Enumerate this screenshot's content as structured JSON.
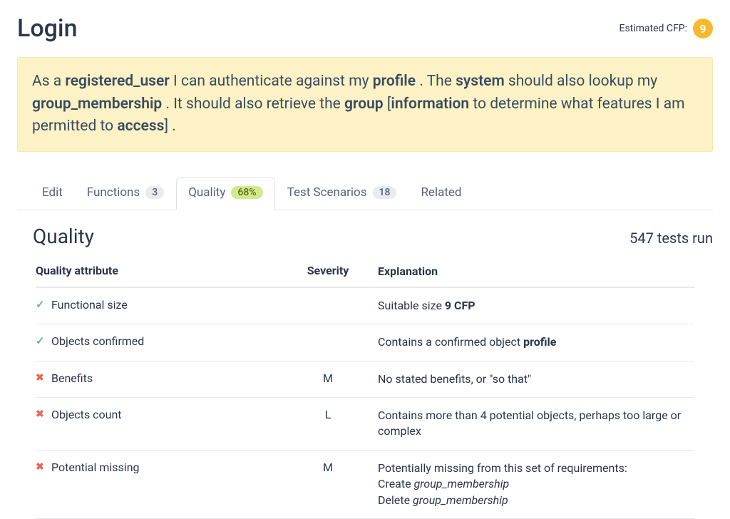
{
  "header": {
    "title": "Login",
    "cfp_label": "Estimated CFP:",
    "cfp_value": "9"
  },
  "story": {
    "s1": "As a ",
    "b1": "registered_user",
    "s2": " I can authenticate against my ",
    "b2": "profile",
    "s3": " . The ",
    "b3": "system",
    "s4": " should also lookup my ",
    "b4": "group_membership",
    "s5": " . It should also retrieve the ",
    "b5": "group",
    "s6": " [",
    "b6": "information",
    "s7": " to determine what features I am permitted to ",
    "b7": "access",
    "s8": "] ."
  },
  "tabs": {
    "edit": "Edit",
    "functions": "Functions",
    "functions_count": "3",
    "quality": "Quality",
    "quality_pct": "68%",
    "test_scenarios": "Test Scenarios",
    "test_scenarios_count": "18",
    "related": "Related"
  },
  "section": {
    "title": "Quality",
    "tests_run": "547 tests run"
  },
  "table": {
    "head_attr": "Quality attribute",
    "head_sev": "Severity",
    "head_exp": "Explanation",
    "rows": [
      {
        "ok": true,
        "attr": "Functional size",
        "sev": "",
        "exp_pre": "Suitable size ",
        "exp_b": "9 CFP",
        "exp_post": ""
      },
      {
        "ok": true,
        "attr": "Objects confirmed",
        "sev": "",
        "exp_pre": "Contains a confirmed object ",
        "exp_b": "profile",
        "exp_post": ""
      },
      {
        "ok": false,
        "attr": "Benefits",
        "sev": "M",
        "exp_pre": "No stated benefits, or \"so that\"",
        "exp_b": "",
        "exp_post": ""
      },
      {
        "ok": false,
        "attr": "Objects count",
        "sev": "L",
        "exp_pre": "Contains more than 4 potential objects, perhaps too large or complex",
        "exp_b": "",
        "exp_post": ""
      },
      {
        "ok": false,
        "attr": "Potential missing",
        "sev": "M",
        "exp_line1": "Potentially missing from this set of requirements:",
        "exp_line2_pre": "Create ",
        "exp_line2_em": "group_membership",
        "exp_line3_pre": "Delete ",
        "exp_line3_em": "group_membership"
      }
    ]
  }
}
